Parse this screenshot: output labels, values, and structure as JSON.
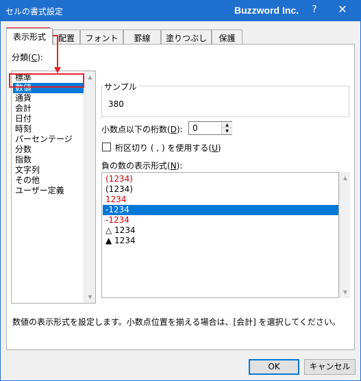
{
  "window": {
    "title": "セルの書式設定",
    "brand": "Buzzword Inc.",
    "help_label": "?",
    "close_label": "✕"
  },
  "tabs": [
    {
      "label": "表示形式",
      "active": true
    },
    {
      "label": "配置",
      "active": false
    },
    {
      "label": "フォント",
      "active": false
    },
    {
      "label": "罫線",
      "active": false
    },
    {
      "label": "塗りつぶし",
      "active": false
    },
    {
      "label": "保護",
      "active": false
    }
  ],
  "category": {
    "label_text": "分類(",
    "label_key": "C",
    "label_end": "):",
    "items": [
      "標準",
      "数値",
      "通貨",
      "会計",
      "日付",
      "時刻",
      "パーセンテージ",
      "分数",
      "指数",
      "文字列",
      "その他",
      "ユーザー定義"
    ],
    "selected_index": 1
  },
  "sample": {
    "label": "サンプル",
    "value": "380"
  },
  "decimal": {
    "label_text": "小数点以下の桁数(",
    "label_key": "D",
    "label_end": "):",
    "value": "0"
  },
  "separator": {
    "label_text": "桁区切り ( , ) を使用する(",
    "label_key": "U",
    "label_end": ")",
    "checked": false
  },
  "negative": {
    "label_text": "負の数の表示形式(",
    "label_key": "N",
    "label_end": "):",
    "items": [
      {
        "text": "(1234)",
        "red": true
      },
      {
        "text": "(1234)",
        "red": false
      },
      {
        "text": "1234",
        "red": true
      },
      {
        "text": "-1234",
        "red": false
      },
      {
        "text": "-1234",
        "red": true
      },
      {
        "text": "△ 1234",
        "red": false
      },
      {
        "text": "▲ 1234",
        "red": false
      }
    ],
    "selected_index": 3
  },
  "description": "数値の表示形式を設定します。小数点位置を揃える場合は、[会計] を選択してください。",
  "buttons": {
    "ok": "OK",
    "cancel": "キャンセル"
  },
  "colors": {
    "titlebar": "#1f6fcf",
    "selection": "#0078d7",
    "negative_red": "#d00000",
    "annotation": "#e0232b"
  }
}
